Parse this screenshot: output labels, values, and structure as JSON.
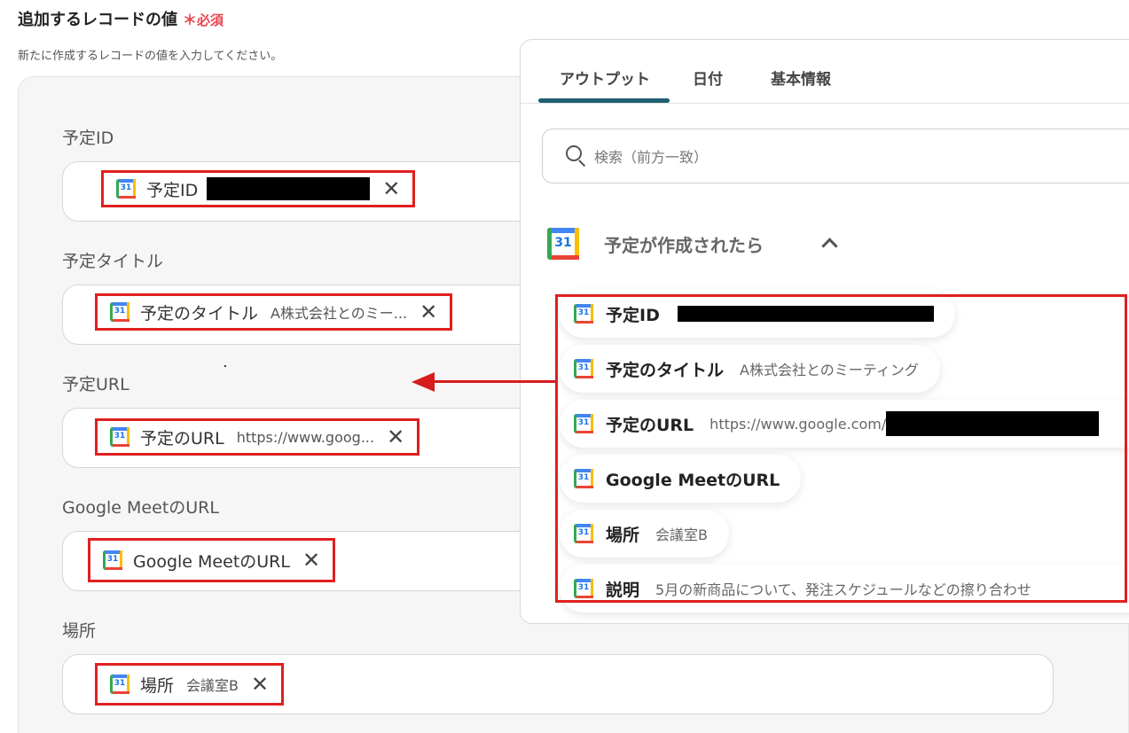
{
  "section": {
    "title": "追加するレコードの値",
    "required_mark": "＊",
    "required_text": "必須",
    "description": "新たに作成するレコードの値を入力してください。"
  },
  "fields": [
    {
      "label": "予定ID",
      "chip_label": "予定ID",
      "chip_value": "",
      "value_redacted": true
    },
    {
      "label": "予定タイトル",
      "chip_label": "予定のタイトル",
      "chip_value": "A株式会社とのミー...",
      "value_redacted": false
    },
    {
      "label": "予定URL",
      "chip_label": "予定のURL",
      "chip_value": "https://www.goog...",
      "value_redacted": false
    },
    {
      "label": "Google MeetのURL",
      "chip_label": "Google MeetのURL",
      "chip_value": "",
      "value_redacted": false
    },
    {
      "label": "場所",
      "chip_label": "場所",
      "chip_value": "会議室B",
      "value_redacted": false
    }
  ],
  "icons": {
    "calendar": "google-calendar-icon",
    "calendar_number": "31",
    "close": "close-icon",
    "search": "search-icon",
    "chevron": "chevron-up-icon",
    "arrow": "arrow-left-icon"
  },
  "colors": {
    "highlight": "#e02020",
    "arrow": "#d61c1c",
    "required": "#e8454f",
    "tab_active": "#1f5f73"
  },
  "popup": {
    "tabs": [
      "アウトプット",
      "日付",
      "基本情報"
    ],
    "active_tab": "アウトプット",
    "search_placeholder": "検索（前方一致）",
    "group_title": "予定が作成されたら",
    "outputs": [
      {
        "label": "予定ID",
        "value": "",
        "value_redacted": true
      },
      {
        "label": "予定のタイトル",
        "value": "A株式会社とのミーティング",
        "value_redacted": false
      },
      {
        "label": "予定のURL",
        "value": "https://www.google.com/",
        "value_redacted": true
      },
      {
        "label": "Google MeetのURL",
        "value": "",
        "value_redacted": false
      },
      {
        "label": "場所",
        "value": "会議室B",
        "value_redacted": false
      },
      {
        "label": "説明",
        "value": "5月の新商品について、発注スケジュールなどの擦り合わせ",
        "value_redacted": false
      }
    ]
  }
}
